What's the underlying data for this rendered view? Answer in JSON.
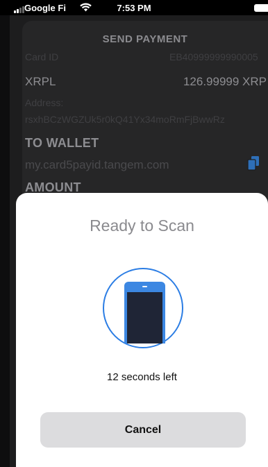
{
  "status_bar": {
    "carrier": "Google Fi",
    "time": "7:53 PM",
    "wifi_icon": "wifi-icon",
    "signal_icon": "signal-bars-icon",
    "battery_icon": "battery-icon"
  },
  "background": {
    "title": "SEND PAYMENT",
    "card_id_label": "Card ID",
    "card_id_value": "EB40999999990005",
    "currency": "XRPL",
    "balance": "126.99999 XRP",
    "address_label": "Address:",
    "address_value": "rsxhBCzWGZUk5r0kQ41Yx34moRmFjBwwRz",
    "to_wallet_label": "TO WALLET",
    "wallet_value": "my.card5payid.tangem.com",
    "paste_icon": "paste-icon",
    "amount_label": "AMOUNT"
  },
  "scan_sheet": {
    "title": "Ready to Scan",
    "phone_icon": "phone-icon",
    "countdown": "12 seconds left",
    "cancel_label": "Cancel"
  },
  "colors": {
    "accent": "#2b7de4",
    "sheet_bg": "#ffffff",
    "dim_bg": "#1d1d1e"
  }
}
